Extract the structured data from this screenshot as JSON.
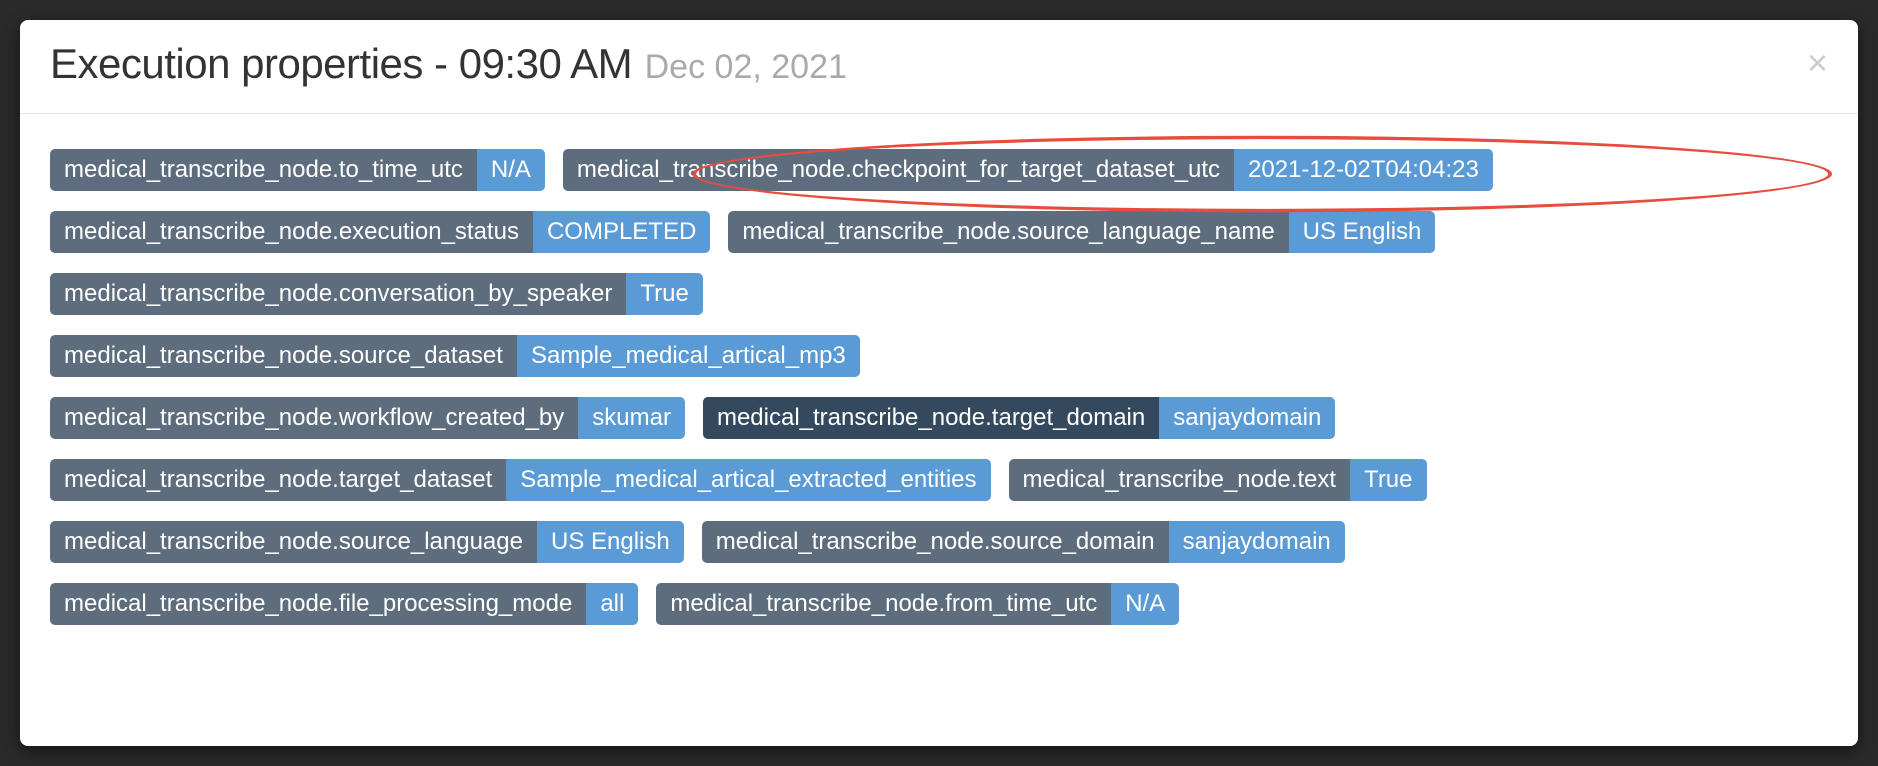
{
  "header": {
    "title": "Execution properties - 09:30 AM",
    "date": "Dec 02, 2021"
  },
  "rows": [
    [
      {
        "key": "medical_transcribe_node.to_time_utc",
        "value": "N/A",
        "dark": false
      },
      {
        "key": "medical_transcribe_node.checkpoint_for_target_dataset_utc",
        "value": "2021-12-02T04:04:23",
        "dark": false
      }
    ],
    [
      {
        "key": "medical_transcribe_node.execution_status",
        "value": "COMPLETED",
        "dark": false
      },
      {
        "key": "medical_transcribe_node.source_language_name",
        "value": "US English",
        "dark": false
      }
    ],
    [
      {
        "key": "medical_transcribe_node.conversation_by_speaker",
        "value": "True",
        "dark": false
      }
    ],
    [
      {
        "key": "medical_transcribe_node.source_dataset",
        "value": "Sample_medical_artical_mp3",
        "dark": false
      }
    ],
    [
      {
        "key": "medical_transcribe_node.workflow_created_by",
        "value": "skumar",
        "dark": false
      },
      {
        "key": "medical_transcribe_node.target_domain",
        "value": "sanjaydomain",
        "dark": true
      }
    ],
    [
      {
        "key": "medical_transcribe_node.target_dataset",
        "value": "Sample_medical_artical_extracted_entities",
        "dark": false
      },
      {
        "key": "medical_transcribe_node.text",
        "value": "True",
        "dark": false
      }
    ],
    [
      {
        "key": "medical_transcribe_node.source_language",
        "value": "US English",
        "dark": false
      },
      {
        "key": "medical_transcribe_node.source_domain",
        "value": "sanjaydomain",
        "dark": false
      }
    ],
    [
      {
        "key": "medical_transcribe_node.file_processing_mode",
        "value": "all",
        "dark": false
      },
      {
        "key": "medical_transcribe_node.from_time_utc",
        "value": "N/A",
        "dark": false
      }
    ]
  ]
}
